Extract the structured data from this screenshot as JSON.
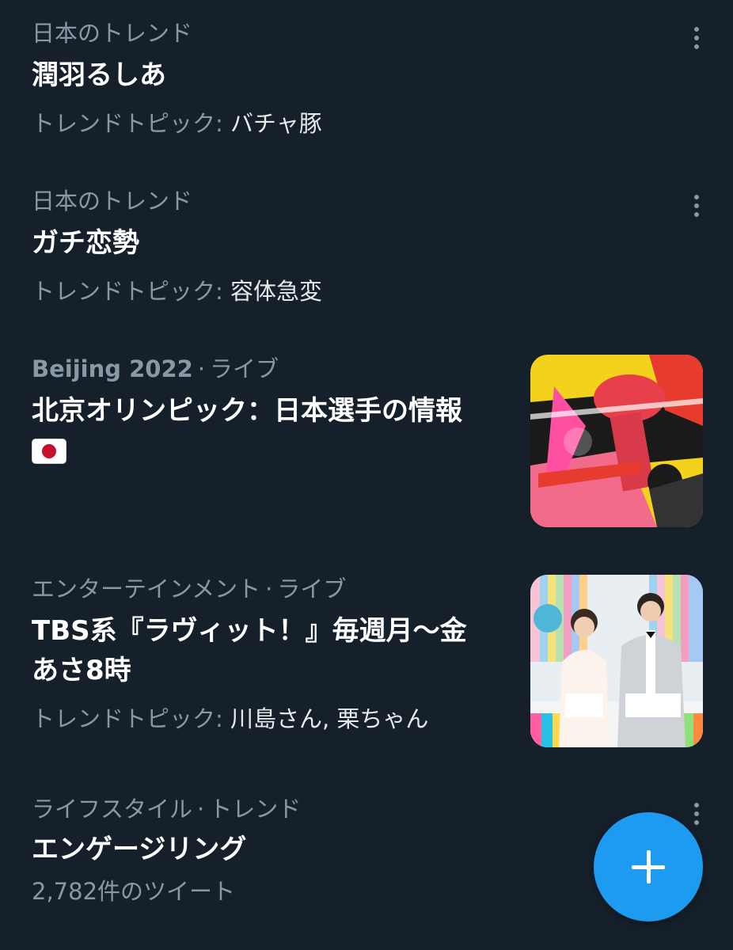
{
  "trends": [
    {
      "category": "日本のトレンド",
      "title": "潤羽るしあ",
      "topic_label": "トレンドトピック:",
      "topic_value": "バチャ豚"
    },
    {
      "category": "日本のトレンド",
      "title": "ガチ恋勢",
      "topic_label": "トレンドトピック:",
      "topic_value": "容体急変"
    },
    {
      "category": "Beijing 2022",
      "separator": "·",
      "status": "ライブ",
      "title": "北京オリンピック：日本選手の情報",
      "flag": "japan-flag-emoji"
    },
    {
      "category": "エンターテインメント",
      "separator": "·",
      "status": "ライブ",
      "title_line1": "TBS系『ラヴィット！』毎週月〜金",
      "title_line2": "あさ8時",
      "topic_label": "トレンドトピック:",
      "topic_value": "川島さん, 栗ちゃん"
    },
    {
      "category": "ライフスタイル",
      "separator": "·",
      "status": "トレンド",
      "title": "エンゲージリング",
      "tweet_count": "2,782件のツイート"
    }
  ],
  "icons": {
    "more": "more-vertical-icon",
    "compose": "plus-icon"
  },
  "colors": {
    "background": "#15202b",
    "secondary_text": "#8899a6",
    "primary_text": "#ffffff",
    "accent": "#1d9bf0"
  }
}
